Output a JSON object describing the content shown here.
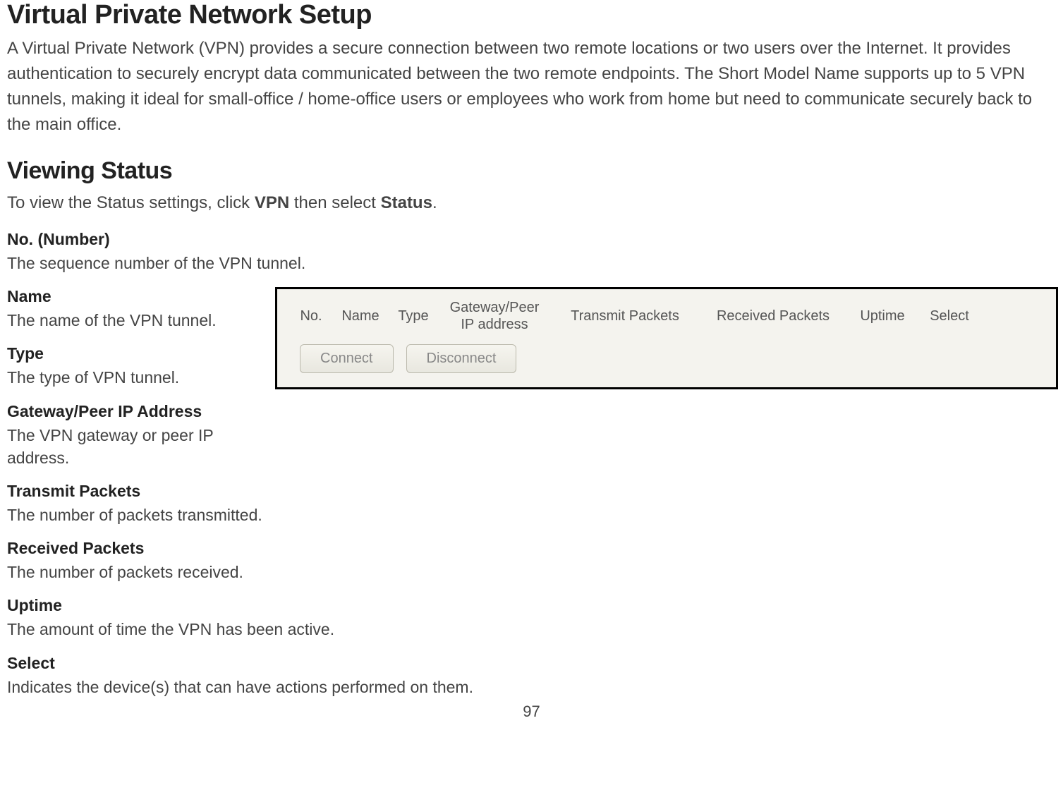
{
  "page": {
    "title": "Virtual Private Network Setup",
    "intro": "A Virtual Private Network (VPN) provides a secure connection between two remote locations or two users over the Internet. It provides authentication to securely encrypt data communicated between the two remote endpoints. The Short Model Name supports up to 5 VPN tunnels, making it ideal for small-office / home-office  users or employees who work from home but need to communicate securely back to the main office.",
    "section2_title": "Viewing Status",
    "instruction_pre": "To view the Status settings, click ",
    "instruction_bold1": "VPN",
    "instruction_mid": " then select ",
    "instruction_bold2": "Status",
    "instruction_post": ".",
    "page_number": "97"
  },
  "definitions": [
    {
      "term": "No. (Number)",
      "desc": "The sequence number of the VPN tunnel."
    },
    {
      "term": "Name",
      "desc": "The name of the VPN tunnel."
    },
    {
      "term": "Type",
      "desc": "The type of VPN tunnel."
    },
    {
      "term": "Gateway/Peer IP Address",
      "desc": "The VPN gateway or peer IP address."
    },
    {
      "term": "Transmit Packets",
      "desc": "The number of packets transmitted."
    },
    {
      "term": "Received Packets",
      "desc": "The number of packets received."
    },
    {
      "term": "Uptime",
      "desc": "The amount of time the VPN has been active."
    },
    {
      "term": "Select",
      "desc": "Indicates the device(s) that can have actions performed on them."
    }
  ],
  "screenshot": {
    "headers": {
      "no": "No.",
      "name": "Name",
      "type": "Type",
      "gateway_line1": "Gateway/Peer",
      "gateway_line2": "IP address",
      "transmit": "Transmit Packets",
      "received": "Received Packets",
      "uptime": "Uptime",
      "select": "Select"
    },
    "buttons": {
      "connect": "Connect",
      "disconnect": "Disconnect"
    }
  }
}
